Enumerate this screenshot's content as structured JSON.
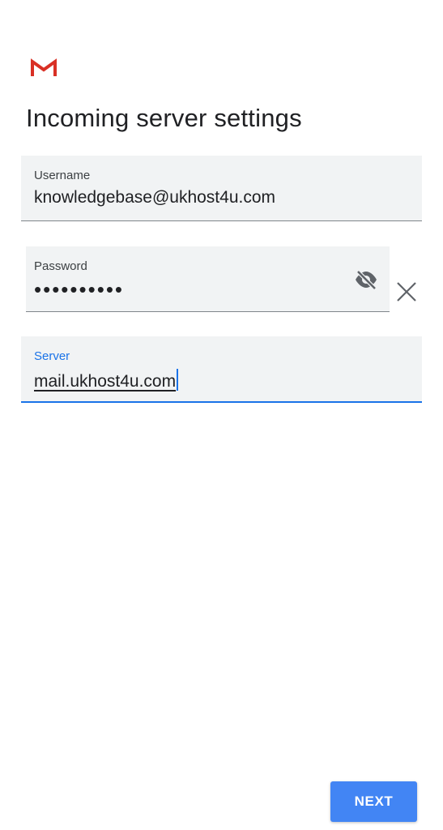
{
  "app": {
    "logo_icon": "gmail-m-icon",
    "brand_color": "#d93025"
  },
  "header": {
    "title": "Incoming server settings"
  },
  "form": {
    "username": {
      "label": "Username",
      "value": "knowledgebase@ukhost4u.com"
    },
    "password": {
      "label": "Password",
      "value": "••••••••••",
      "visibility_icon": "eye-off-icon"
    },
    "password_clear_icon": "close-icon",
    "server": {
      "label": "Server",
      "value": "mail.ukhost4u.com",
      "focused": true
    }
  },
  "footer": {
    "next_label": "NEXT"
  },
  "colors": {
    "accent": "#1a73e8",
    "button": "#4285f4",
    "field_bg": "#f1f3f4",
    "icon_grey": "#5f6368"
  }
}
